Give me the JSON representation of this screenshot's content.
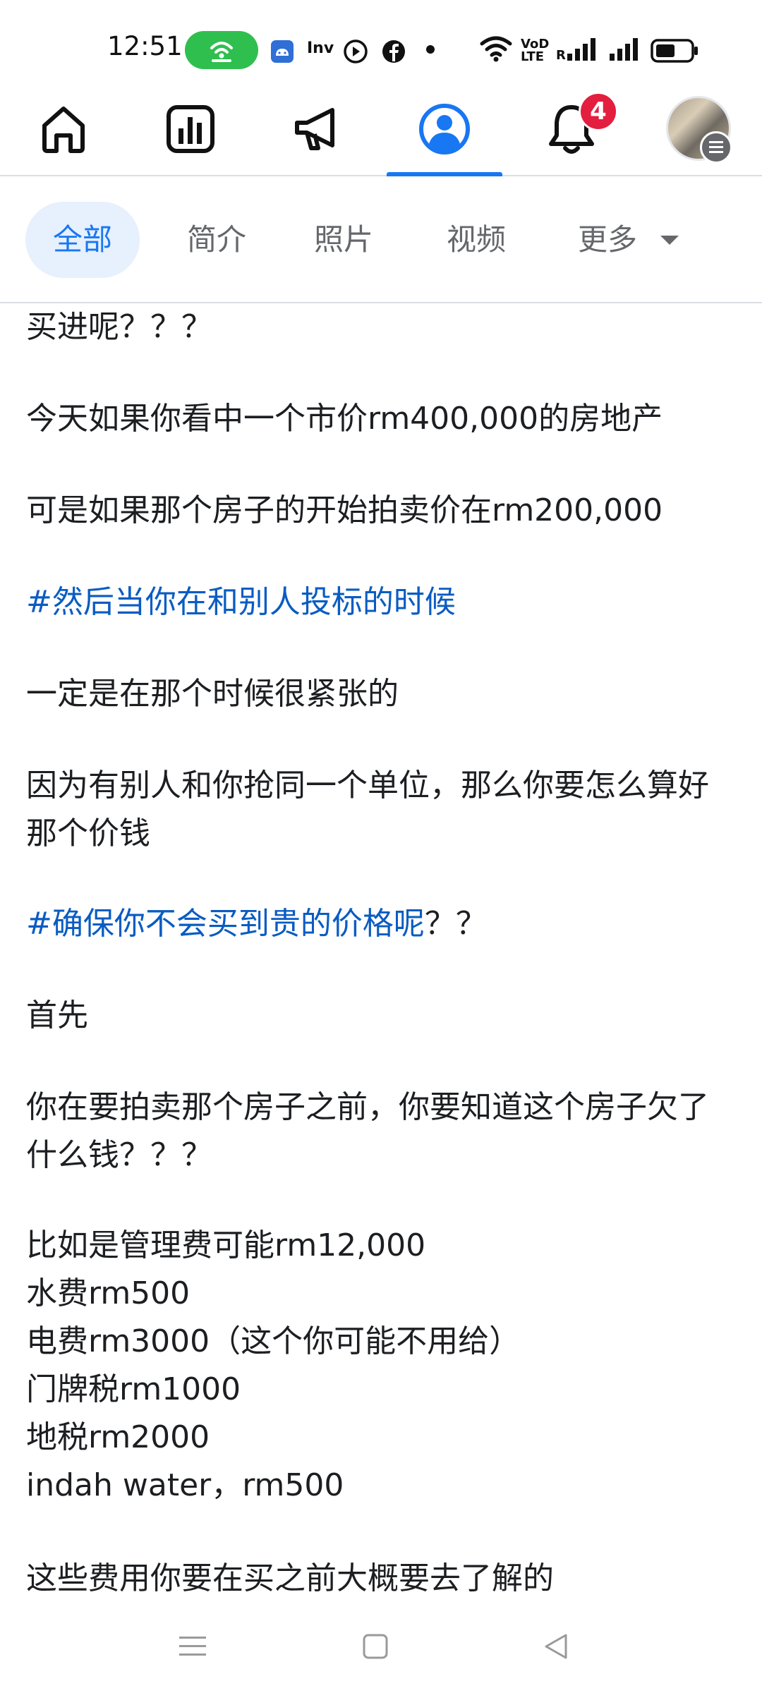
{
  "status_bar": {
    "time": "12:51",
    "inv_label": "Inv",
    "volte_label_1": "VoD",
    "volte_label_2": "LTE",
    "roaming_label": "R",
    "icons": [
      "hotspot-icon",
      "android-icon",
      "inv-icon",
      "record-icon",
      "facebook-icon",
      "dot-icon",
      "wifi-icon",
      "signal-icon",
      "battery-icon"
    ]
  },
  "nav": {
    "items": [
      "home-icon",
      "dashboard-icon",
      "megaphone-icon",
      "profile-icon",
      "notifications-icon",
      "avatar-menu"
    ],
    "active": "profile-icon",
    "notification_count": "4",
    "accent": "#1877f2",
    "badge_color": "#e41e3f"
  },
  "filter_tabs": [
    {
      "label": "全部",
      "active": true
    },
    {
      "label": "简介",
      "active": false
    },
    {
      "label": "照片",
      "active": false
    },
    {
      "label": "视频",
      "active": false
    },
    {
      "label": "更多",
      "active": false
    }
  ],
  "post": {
    "line_01": "买进呢？？？",
    "line_02": "今天如果你看中一个市价rm400,000的房地产",
    "line_03": "可是如果那个房子的开始拍卖价在rm200,000",
    "line_04": "#然后当你在和别人投标的时候",
    "line_05": "一定是在那个时候很紧张的",
    "line_06": "因为有别人和你抢同一个单位，那么你要怎么算好那个价钱",
    "line_07_tag": "#确保你不会买到贵的价格呢",
    "line_07_rest": "？？",
    "line_08": "首先",
    "line_09": "你在要拍卖那个房子之前，你要知道这个房子欠了什么钱？？？",
    "line_10": "比如是管理费可能rm12,000",
    "line_11": "水费rm500",
    "line_12": "电费rm3000（这个你可能不用给）",
    "line_13": "门牌税rm1000",
    "line_14": "地税rm2000",
    "line_15": "indah water，rm500",
    "line_16": "这些费用你要在买之前大概要去了解的",
    "hashtag_color": "#0a5cc2"
  },
  "system_nav": [
    "menu-icon",
    "home-square-icon",
    "back-icon"
  ]
}
